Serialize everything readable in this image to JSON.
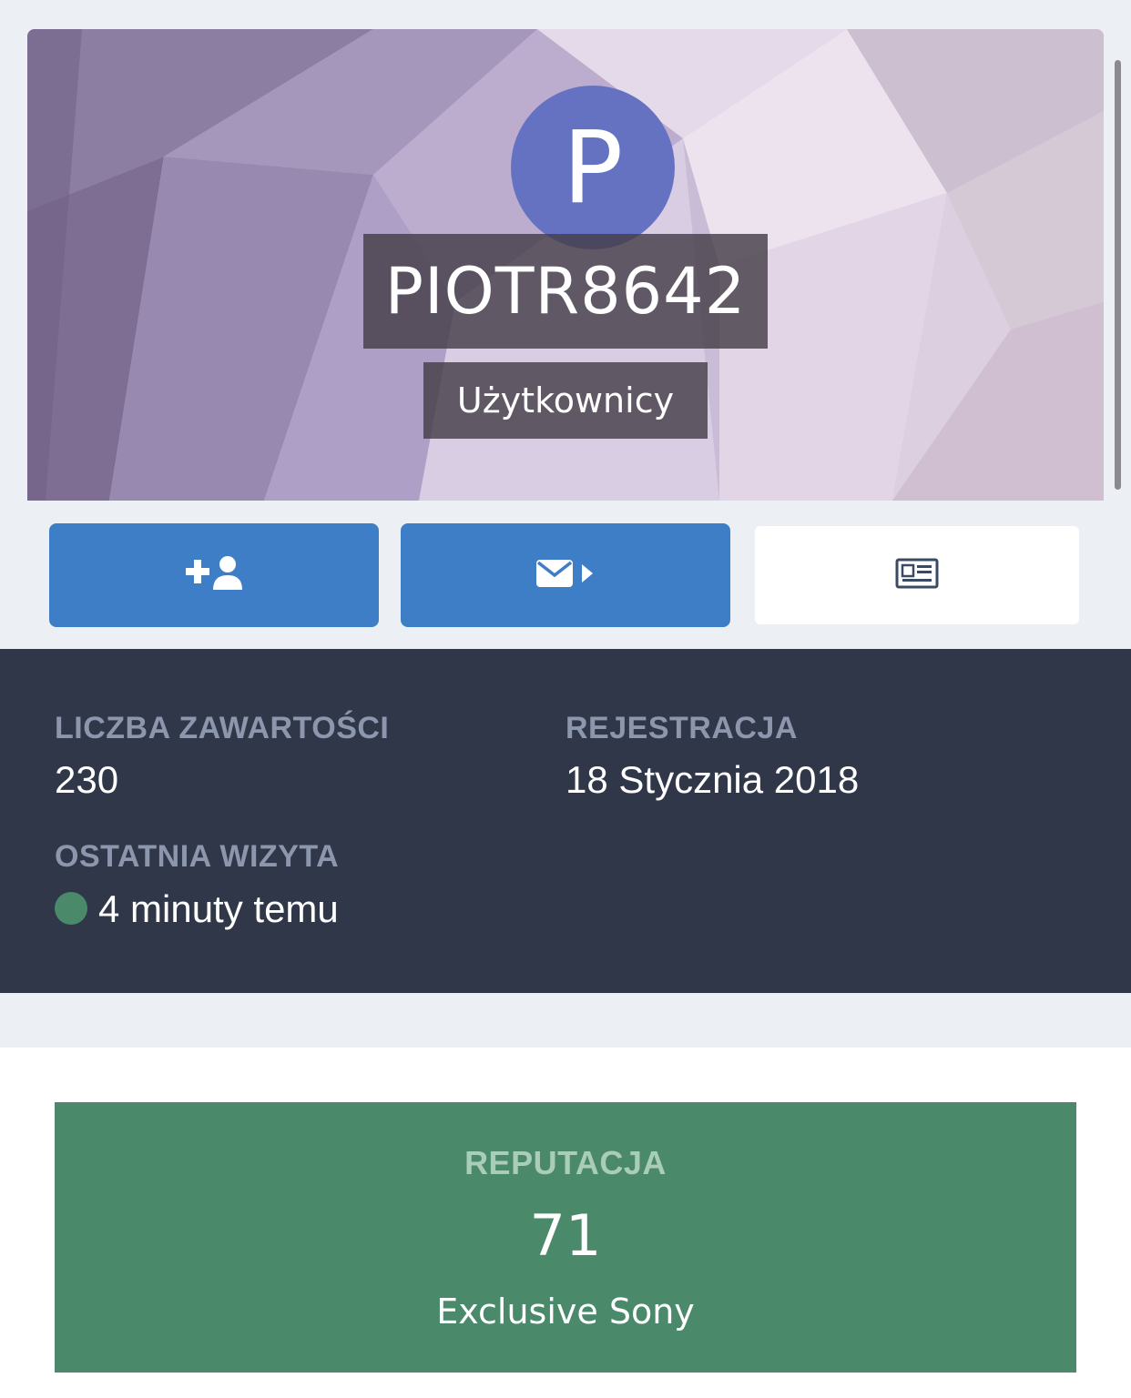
{
  "profile": {
    "avatar_letter": "P",
    "username": "PIOTR8642",
    "group": "Użytkownicy"
  },
  "actions": [
    {
      "icon": "add-user-icon"
    },
    {
      "icon": "send-message-icon"
    },
    {
      "icon": "newspaper-icon"
    }
  ],
  "stats": {
    "content_label": "LICZBA ZAWARTOŚCI",
    "content_value": "230",
    "joined_label": "REJESTRACJA",
    "joined_value": "18 Stycznia 2018",
    "last_visit_label": "OSTATNIA WIZYTA",
    "last_visit_value": "4 minuty temu"
  },
  "reputation": {
    "label": "REPUTACJA",
    "value": "71",
    "rank": "Exclusive Sony"
  },
  "colors": {
    "accent_blue": "#3d7ec6",
    "dark_panel": "#303748",
    "reputation_green": "#4a8a6b",
    "online_green": "#4a8a6a",
    "avatar_bg": "#6572c2"
  }
}
